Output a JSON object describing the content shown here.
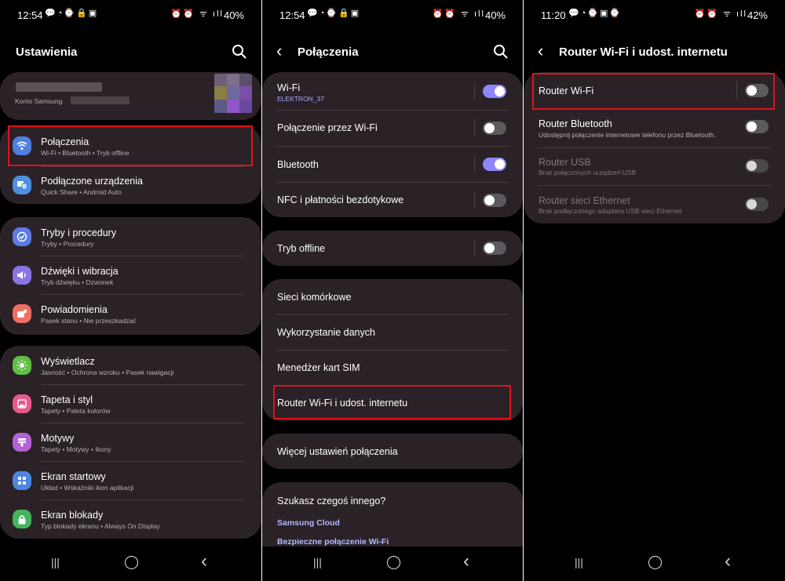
{
  "panel1": {
    "status": {
      "time": "12:54",
      "notif_icons": "💬◔⌚🔒▣",
      "sys_icons": "⏰⏰ ᯤ ıll",
      "battery": "40%"
    },
    "header": {
      "title": "Ustawienia"
    },
    "account": {
      "label": "Konto Samsung"
    },
    "groups": [
      {
        "items": [
          {
            "label": "Połączenia",
            "sub": "Wi-Fi  •  Bluetooth  •  Tryb offline",
            "icon": "wifi-icon",
            "color": "#4f7fdf"
          },
          {
            "label": "Podłączone urządzenia",
            "sub": "Quick Share  •  Android Auto",
            "icon": "devices-icon",
            "color": "#4f8fe0"
          }
        ]
      },
      {
        "items": [
          {
            "label": "Tryby i procedury",
            "sub": "Tryby  •  Procedury",
            "icon": "check-circle-icon",
            "color": "#5a7ae6"
          },
          {
            "label": "Dźwięki i wibracja",
            "sub": "Tryb dźwięku  •  Dzwonek",
            "icon": "volume-icon",
            "color": "#8a74e3"
          },
          {
            "label": "Powiadomienia",
            "sub": "Pasek stanu  •  Nie przeszkadzać",
            "icon": "notification-icon",
            "color": "#ef6f61"
          }
        ]
      },
      {
        "items": [
          {
            "label": "Wyświetlacz",
            "sub": "Jasność  •  Ochrona wzroku  •  Pasek nawigacji",
            "icon": "brightness-icon",
            "color": "#5fbf46"
          },
          {
            "label": "Tapeta i styl",
            "sub": "Tapety  •  Paleta kolorów",
            "icon": "wallpaper-icon",
            "color": "#e95a8c"
          },
          {
            "label": "Motywy",
            "sub": "Tapety  •  Motywy  •  Ikony",
            "icon": "themes-icon",
            "color": "#b562d6"
          },
          {
            "label": "Ekran startowy",
            "sub": "Układ  •  Wskaźniki ikon aplikacji",
            "icon": "home-screen-icon",
            "color": "#4c86e0"
          },
          {
            "label": "Ekran blokady",
            "sub": "Typ blokady ekranu  •  Always On Display",
            "icon": "lock-icon",
            "color": "#46b45b"
          }
        ]
      }
    ]
  },
  "panel2": {
    "status": {
      "time": "12:54",
      "notif_icons": "💬◔⌚🔒▣",
      "sys_icons": "⏰⏰ ᯤ ıll",
      "battery": "40%"
    },
    "header": {
      "title": "Połączenia"
    },
    "group1": [
      {
        "label": "Wi-Fi",
        "sub": "ELEKTRON_37",
        "toggle": true,
        "divider": true
      },
      {
        "label": "Połączenie przez Wi-Fi",
        "toggle": false,
        "divider": true
      },
      {
        "label": "Bluetooth",
        "toggle": true,
        "divider": true
      },
      {
        "label": "NFC i płatności bezdotykowe",
        "toggle": false,
        "divider": true
      }
    ],
    "group2": [
      {
        "label": "Tryb offline",
        "toggle": false,
        "divider": true
      }
    ],
    "group3": [
      {
        "label": "Sieci komórkowe"
      },
      {
        "label": "Wykorzystanie danych"
      },
      {
        "label": "Menedżer kart SIM"
      },
      {
        "label": "Router Wi-Fi i udost. internetu"
      }
    ],
    "group4": [
      {
        "label": "Więcej ustawień połączenia"
      }
    ],
    "suggest": {
      "question": "Szukasz czegoś innego?",
      "links": [
        "Samsung Cloud",
        "Bezpieczne połączenie Wi-Fi"
      ]
    }
  },
  "panel3": {
    "status": {
      "time": "11:20",
      "notif_icons": "💬◔⌚▣⌚",
      "sys_icons": "⏰⏰ ᯤ ıll",
      "battery": "42%"
    },
    "header": {
      "title": "Router Wi-Fi i udost. internetu"
    },
    "rows": [
      {
        "label": "Router Wi-Fi",
        "sub": "",
        "toggle": false,
        "enabled": true,
        "divider": true
      },
      {
        "label": "Router Bluetooth",
        "sub": "Udostępnij połączenie internetowe telefonu przez Bluetooth.",
        "toggle": false,
        "enabled": true
      },
      {
        "label": "Router USB",
        "sub": "Brak połączonych urządzeń USB",
        "toggle": false,
        "enabled": false
      },
      {
        "label": "Router sieci Ethernet",
        "sub": "Brak podłączonego adaptera USB sieci Ethernet",
        "toggle": false,
        "enabled": false
      }
    ]
  },
  "nav": {
    "recents": "|||",
    "home": "◯",
    "back": "‹"
  }
}
